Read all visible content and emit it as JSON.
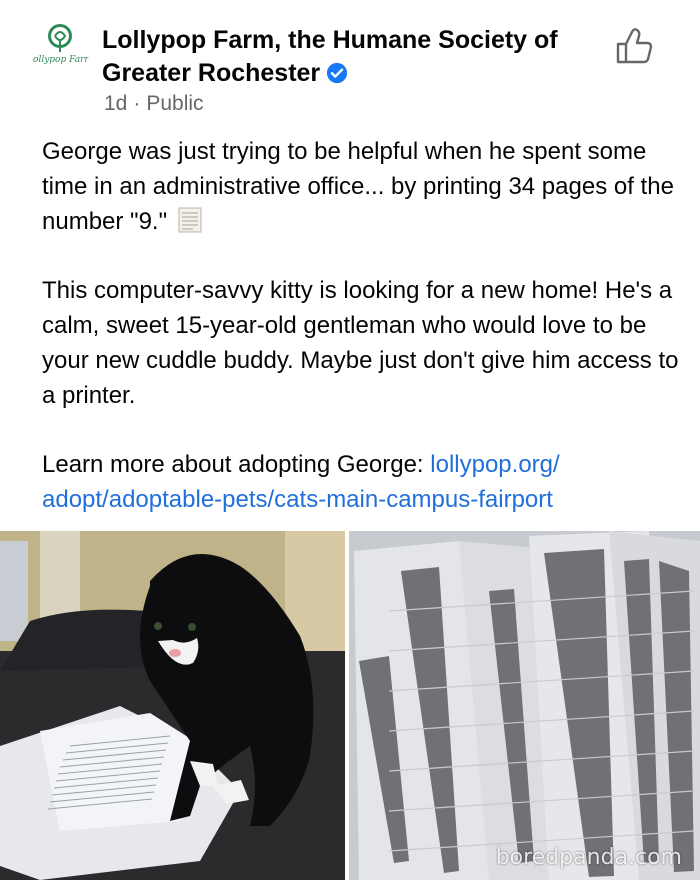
{
  "post": {
    "page_name": "Lollypop Farm, the Humane Society of Greater Rochester",
    "avatar_logo_text": "Lollypop Farm",
    "time": "1d",
    "separator": "·",
    "visibility": "Public",
    "paragraph_1": "George was just trying to be helpful when he spent some time in an administrative office... by printing 34 pages of the number \"9.\"",
    "paragraph_2": "This computer-savvy kitty is looking for a new home! He's a calm, sweet 15-year-old gentleman who would love to be your new cuddle buddy. Maybe just don't give him access to a printer.",
    "paragraph_3_prefix": "Learn more about adopting George: ",
    "link_line_1": "lollypop.org/",
    "link_line_2": "adopt/adoptable-pets/cats-main-campus-fairport"
  },
  "photos": {
    "left_description": "black and white cat standing on printed pages",
    "right_description": "printed pages filled with the number 9",
    "watermark": "boredpanda.com"
  },
  "colors": {
    "link": "#216fdb",
    "verified": "#1877f2",
    "meta": "#65676b",
    "brand_green": "#2e8b57"
  },
  "icons": {
    "like": "thumbs-up-outline-icon",
    "verified": "verified-badge-icon",
    "emoji": "scroll-page-emoji-icon"
  }
}
